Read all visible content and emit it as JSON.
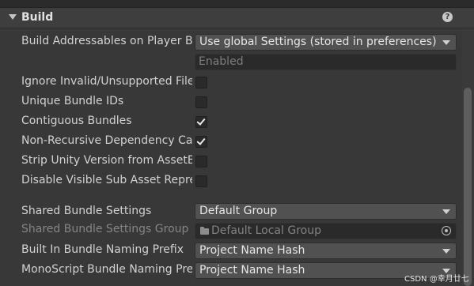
{
  "section": {
    "title": "Build"
  },
  "rows": {
    "build_addressables": {
      "label": "Build Addressables on Player Build",
      "value": "Use global Settings (stored in preferences)"
    },
    "build_state": {
      "value": "Enabled"
    },
    "ignore_invalid": {
      "label": "Ignore Invalid/Unsupported Files in Build",
      "checked": false
    },
    "unique_bundle_ids": {
      "label": "Unique Bundle IDs",
      "checked": false
    },
    "contiguous_bundles": {
      "label": "Contiguous Bundles",
      "checked": true
    },
    "non_recursive": {
      "label": "Non-Recursive Dependency Calculation",
      "checked": true
    },
    "strip_unity_version": {
      "label": "Strip Unity Version from AssetBundles",
      "checked": false
    },
    "disable_visible_sub_asset": {
      "label": "Disable Visible Sub Asset Representations",
      "checked": false
    },
    "shared_bundle_settings": {
      "label": "Shared Bundle Settings",
      "value": "Default Group"
    },
    "shared_bundle_settings_group": {
      "label": "Shared Bundle Settings Group",
      "value": "Default Local Group"
    },
    "built_in_naming": {
      "label": "Built In Bundle Naming Prefix",
      "value": "Project Name Hash"
    },
    "monoscript_naming": {
      "label": "MonoScript Bundle Naming Prefix",
      "value": "Project Name Hash"
    }
  },
  "watermark": "CSDN @幸月廿七",
  "icons": {
    "help": "?",
    "fold": "fold-arrow-icon"
  }
}
